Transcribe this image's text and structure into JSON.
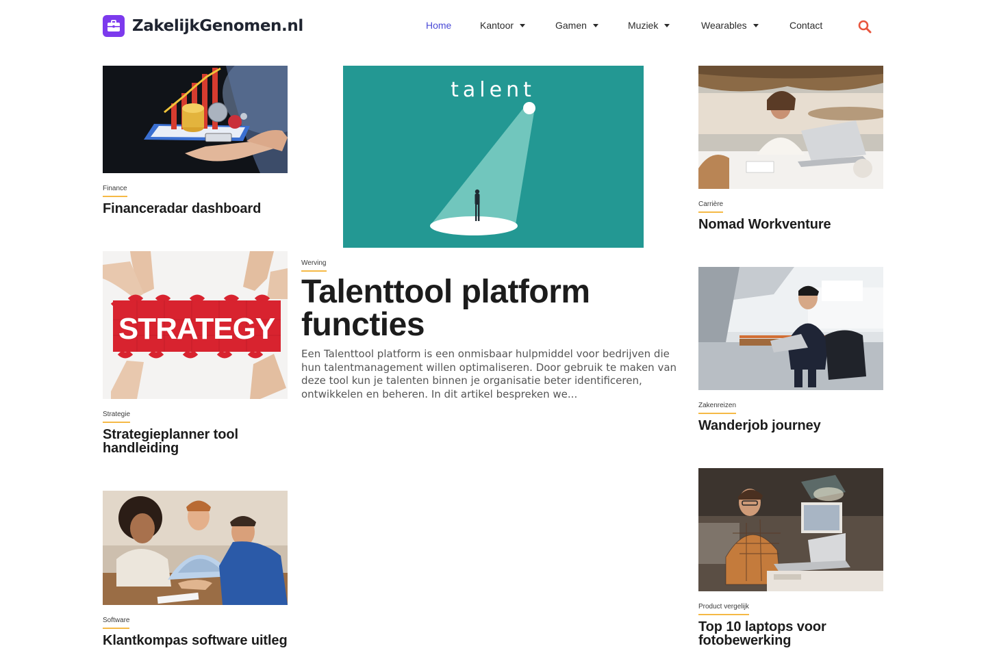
{
  "site": {
    "name": "ZakelijkGenomen.nl",
    "brand_color": "#7c3aed"
  },
  "nav": {
    "items": [
      {
        "label": "Home",
        "active": true,
        "dropdown": false
      },
      {
        "label": "Kantoor",
        "active": false,
        "dropdown": true
      },
      {
        "label": "Gamen",
        "active": false,
        "dropdown": true
      },
      {
        "label": "Muziek",
        "active": false,
        "dropdown": true
      },
      {
        "label": "Wearables",
        "active": false,
        "dropdown": true
      },
      {
        "label": "Contact",
        "active": false,
        "dropdown": false
      }
    ],
    "search_icon": "search-icon",
    "accent_color": "#4a4ad6",
    "search_color": "#e8553d"
  },
  "featured": {
    "image_text": "talent",
    "category": "Werving",
    "title": "Talenttool platform functies",
    "excerpt": "Een Talenttool platform is een onmisbaar hulpmiddel voor bedrijven die hun talentmanagement willen optimaliseren. Door gebruik te maken van deze tool kun je talenten binnen je organisatie beter identificeren, ontwikkelen en beheren. In dit artikel bespreken we..."
  },
  "left_column": [
    {
      "category": "Finance",
      "title": "Financeradar dashboard"
    },
    {
      "category": "Strategie",
      "title": "Strategieplanner tool handleiding",
      "image_text": "STRATEGY"
    },
    {
      "category": "Software",
      "title": "Klantkompas software uitleg"
    }
  ],
  "right_column": [
    {
      "category": "Carrière",
      "title": "Nomad Workventure"
    },
    {
      "category": "Zakenreizen",
      "title": "Wanderjob journey"
    },
    {
      "category": "Product vergelijk",
      "title": "Top 10 laptops voor fotobewerking"
    }
  ],
  "category_underline_color": "#f5b945"
}
